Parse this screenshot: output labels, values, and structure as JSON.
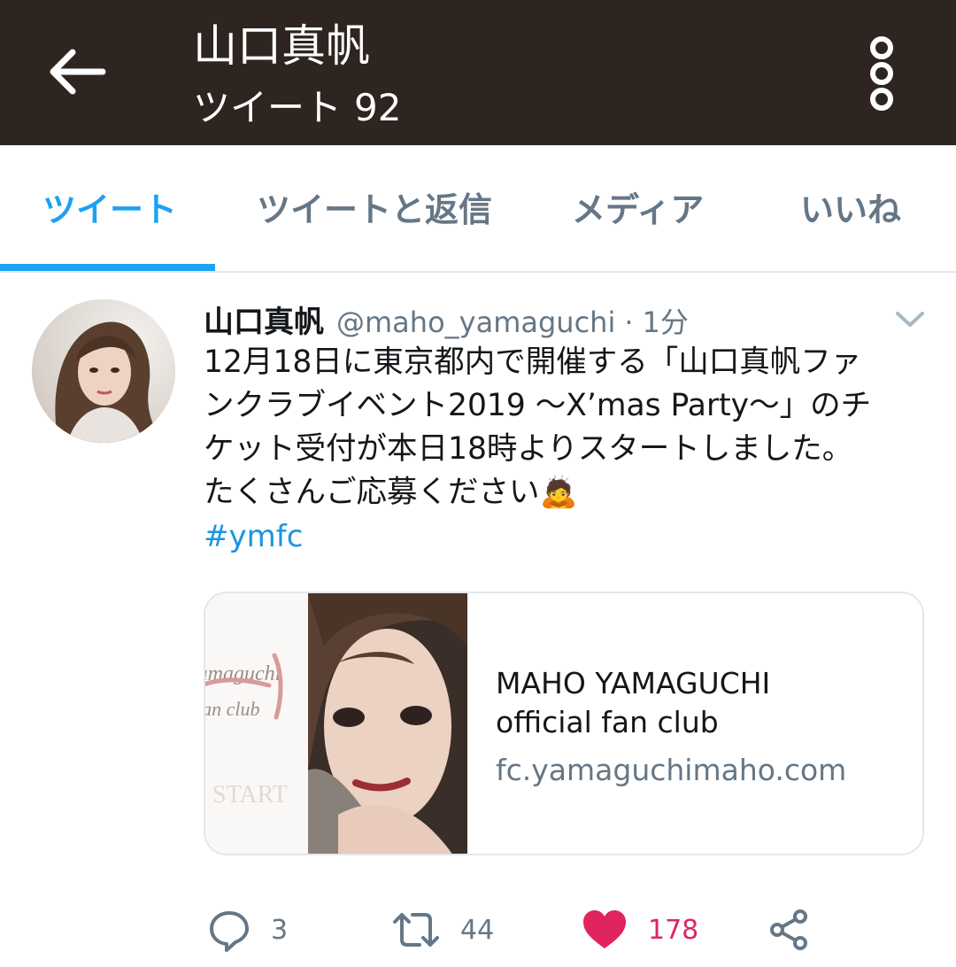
{
  "header": {
    "title": "山口真帆",
    "subtitle_label": "ツイート",
    "tweet_count": "92",
    "back_icon": "arrow-left-icon",
    "more_icon": "more-vertical-icon",
    "bg_color": "#2e2520"
  },
  "tabs": [
    {
      "label": "ツイート",
      "active": true
    },
    {
      "label": "ツイートと返信",
      "active": false
    },
    {
      "label": "メディア",
      "active": false
    },
    {
      "label": "いいね",
      "active": false
    }
  ],
  "tweet": {
    "author_name": "山口真帆",
    "handle": "@maho_yamaguchi",
    "separator": "·",
    "time": "1分",
    "text_lines": [
      "12月18日に東京都内で開催する「山口真帆ファ",
      "ンクラブイベント2019 〜X’mas Party〜」のチ",
      "ケット受付が本日18時よりスタートしました。",
      "たくさんご応募ください🙇"
    ],
    "hashtag": "#ymfc",
    "card": {
      "title": "MAHO YAMAGUCHI",
      "description": "official fan club",
      "domain": "fc.yamaguchimaho.com",
      "image_text_line1": "yamaguchi",
      "image_text_line2": "fan club",
      "image_start": "START"
    },
    "actions": {
      "reply_count": "3",
      "retweet_count": "44",
      "like_count": "178",
      "liked": true
    }
  },
  "colors": {
    "accent": "#1da1f2",
    "like": "#e0245e",
    "secondary_text": "#657786"
  }
}
